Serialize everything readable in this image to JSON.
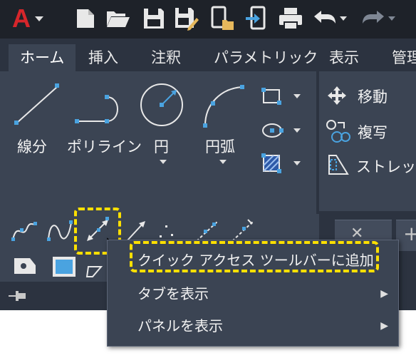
{
  "app": {
    "logo_letter": "A",
    "accent_color": "#d6262b",
    "highlight_color": "#ffe000"
  },
  "quick_access_toolbar": {
    "items": [
      {
        "icon": "autocad-logo-icon"
      },
      {
        "icon": "new-file-icon"
      },
      {
        "icon": "open-folder-icon"
      },
      {
        "icon": "save-icon"
      },
      {
        "icon": "save-as-icon"
      },
      {
        "icon": "open-from-mobile-icon"
      },
      {
        "icon": "save-to-mobile-icon"
      },
      {
        "icon": "print-icon"
      },
      {
        "icon": "undo-icon"
      },
      {
        "icon": "redo-icon"
      }
    ]
  },
  "tabs": [
    "ホーム",
    "挿入",
    "注釈",
    "パラメトリック",
    "表示",
    "管理"
  ],
  "active_tab": "ホーム",
  "draw_panel": {
    "line_label": "線分",
    "polyline_label": "ポリライン",
    "circle_label": "円",
    "arc_label": "円弧"
  },
  "modify_panel": {
    "move_label": "移動",
    "copy_label": "複写",
    "stretch_label": "ストレッチ"
  },
  "context_menu": {
    "items": [
      {
        "label": "クイック アクセス ツールバーに追加",
        "has_submenu": false
      },
      {
        "label": "タブを表示",
        "has_submenu": true
      },
      {
        "label": "パネルを表示",
        "has_submenu": true
      }
    ],
    "submenu_arrow": "▶"
  },
  "document_tab": {
    "close_glyph": "✕",
    "new_glyph": "+"
  }
}
